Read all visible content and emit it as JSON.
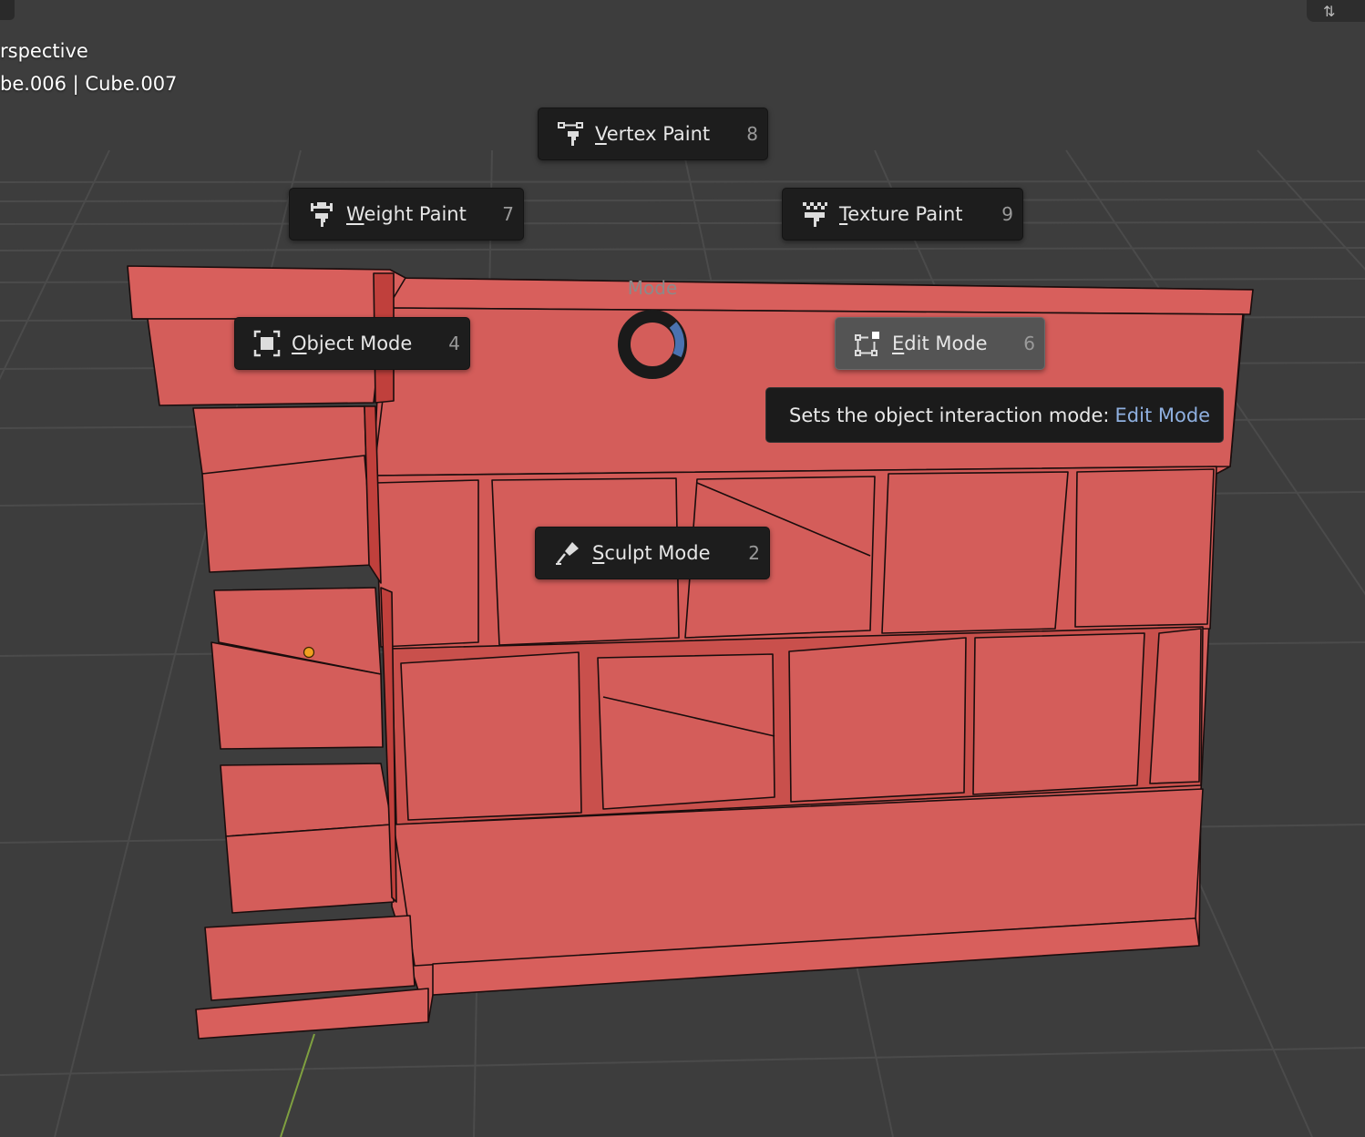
{
  "viewport": {
    "view_label": "rspective",
    "objects_label": "be.006 | Cube.007",
    "corner_icon": "overlay-toggle-icon"
  },
  "pie_menu": {
    "title": "Mode",
    "items": [
      {
        "id": "vertex-paint",
        "label_first": "V",
        "label_rest": "ertex Paint",
        "shortcut": "8",
        "icon": "vertex-paint-icon"
      },
      {
        "id": "weight-paint",
        "label_first": "W",
        "label_rest": "eight Paint",
        "shortcut": "7",
        "icon": "weight-paint-icon"
      },
      {
        "id": "texture-paint",
        "label_first": "T",
        "label_rest": "exture Paint",
        "shortcut": "9",
        "icon": "texture-paint-icon"
      },
      {
        "id": "object-mode",
        "label_first": "O",
        "label_rest": "bject Mode",
        "shortcut": "4",
        "icon": "object-mode-icon"
      },
      {
        "id": "edit-mode",
        "label_first": "E",
        "label_rest": "dit Mode",
        "shortcut": "6",
        "icon": "edit-mode-icon",
        "active": true
      },
      {
        "id": "sculpt-mode",
        "label_first": "S",
        "label_rest": "culpt Mode",
        "shortcut": "2",
        "icon": "sculpt-mode-icon"
      }
    ]
  },
  "tooltip": {
    "text": "Sets the object interaction mode:",
    "value": "Edit Mode"
  },
  "colors": {
    "background": "#3d3d3d",
    "grid": "#4a4a4a",
    "mesh_face": "#d45d5a",
    "mesh_shadow": "#c0403c",
    "mesh_edge": "#1a0d0d",
    "menu_bg": "#1d1d1d",
    "active_bg": "#545454",
    "accent_blue": "#8fb0e0",
    "y_axis": "#7fa040",
    "origin_dot": "#f0a020"
  }
}
